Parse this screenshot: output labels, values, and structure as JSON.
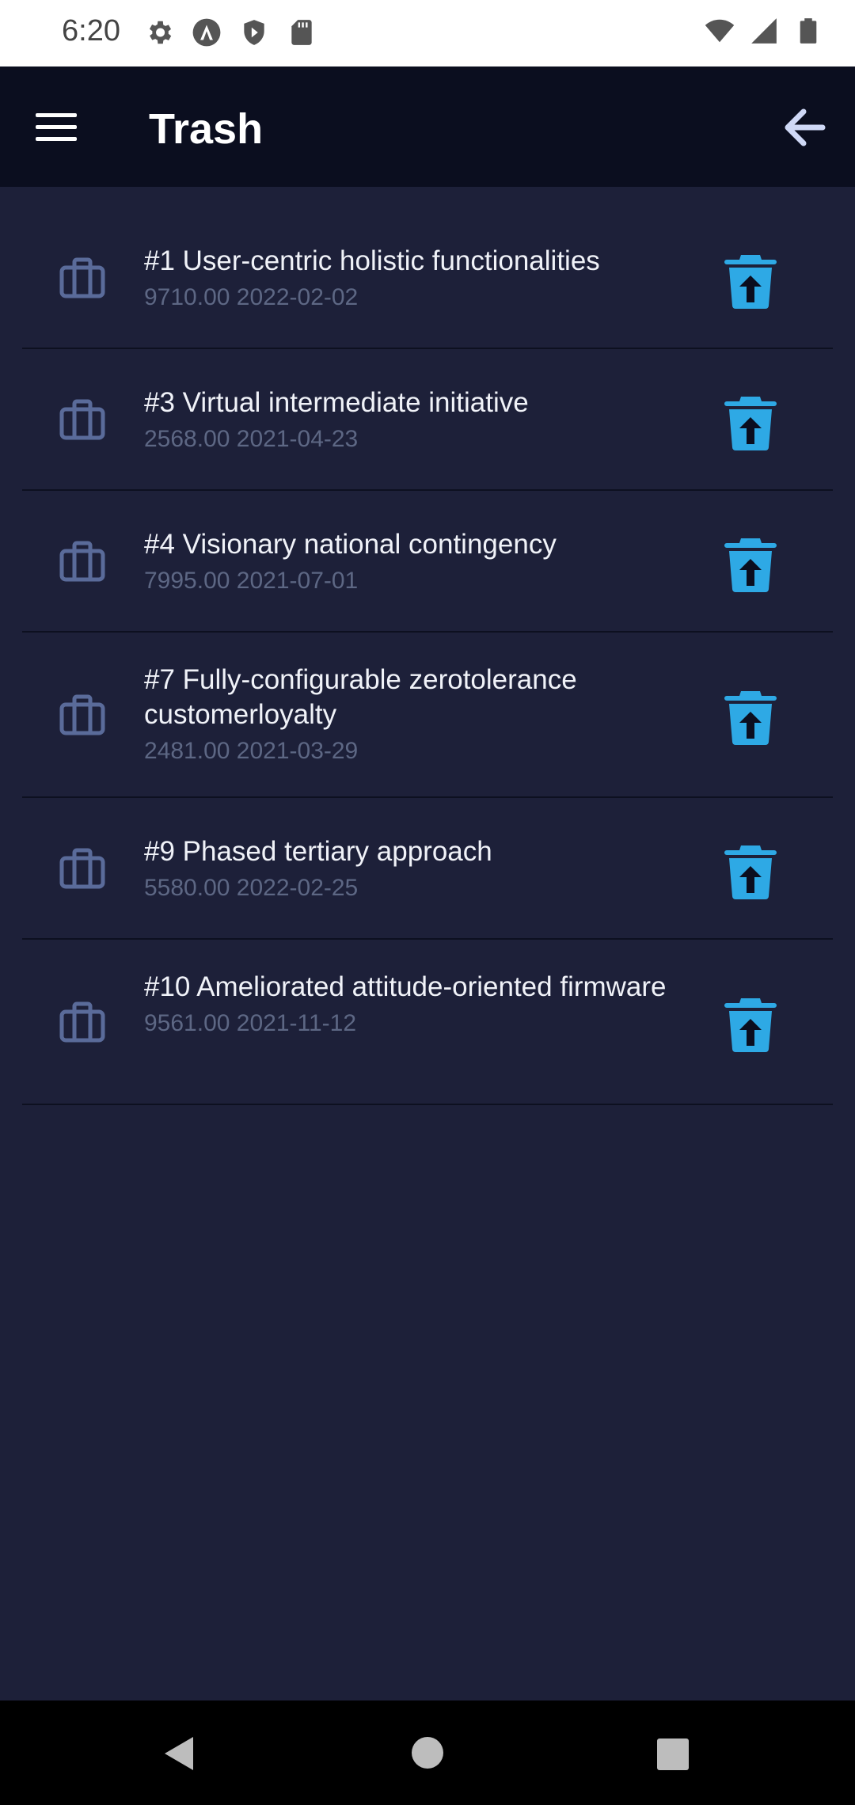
{
  "status_bar": {
    "time": "6:20",
    "left_icons": [
      "settings-icon",
      "a-circle-icon",
      "shield-play-icon",
      "sd-card-icon"
    ],
    "right_icons": [
      "wifi-icon",
      "cell-signal-icon",
      "battery-icon"
    ]
  },
  "app_bar": {
    "title": "Trash",
    "menu_icon": "hamburger-menu-icon",
    "back_icon": "arrow-left-icon"
  },
  "items": [
    {
      "title": "#1 User-centric holistic functionalities",
      "subtitle": "9710.00 2022-02-02",
      "lines": 1
    },
    {
      "title": "#3 Virtual intermediate initiative",
      "subtitle": "2568.00 2021-04-23",
      "lines": 1
    },
    {
      "title": "#4 Visionary national contingency",
      "subtitle": "7995.00 2021-07-01",
      "lines": 1
    },
    {
      "title": "#7 Fully-configurable zerotolerance customerloyalty",
      "subtitle": "2481.00 2021-03-29",
      "lines": 2
    },
    {
      "title": "#9 Phased tertiary approach",
      "subtitle": "5580.00 2022-02-25",
      "lines": 1
    },
    {
      "title": "#10 Ameliorated attitude-oriented firmware",
      "subtitle": "9561.00 2021-11-12",
      "lines": 2
    }
  ],
  "item_icons": {
    "leading": "briefcase-icon",
    "action": "trash-restore-icon"
  },
  "colors": {
    "background": "#1d2039",
    "app_bar": "#0b0e1f",
    "accent": "#2ea9e5",
    "leading_icon": "#5a6b9a",
    "subtitle": "#5d6784"
  },
  "nav_bar": {
    "icons": [
      "back-triangle-icon",
      "home-circle-icon",
      "recents-square-icon"
    ]
  }
}
